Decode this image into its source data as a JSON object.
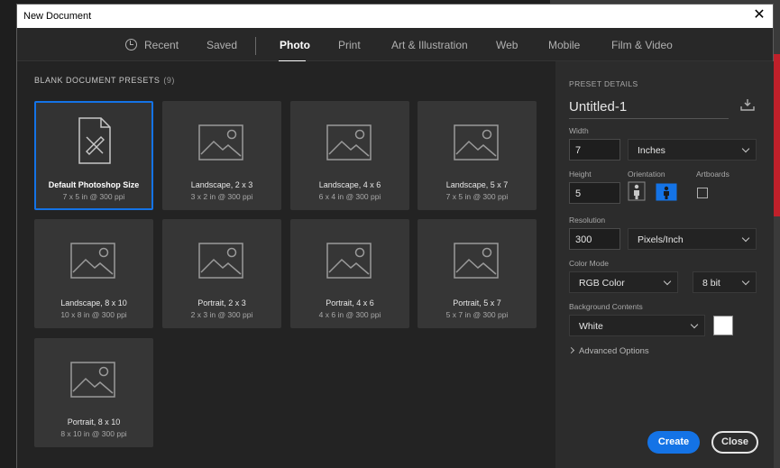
{
  "window": {
    "title": "New Document",
    "close_glyph": "✕"
  },
  "tabs": [
    {
      "label": "Recent",
      "icon": "clock-icon"
    },
    {
      "label": "Saved"
    },
    {
      "label": "Photo",
      "active": true
    },
    {
      "label": "Print"
    },
    {
      "label": "Art & Illustration"
    },
    {
      "label": "Web"
    },
    {
      "label": "Mobile"
    },
    {
      "label": "Film & Video"
    }
  ],
  "presets": {
    "header": "BLANK DOCUMENT PRESETS",
    "count": "(9)",
    "items": [
      {
        "name": "Default Photoshop Size",
        "size": "7 x 5 in @ 300 ppi",
        "icon": "document-brush-icon",
        "selected": true
      },
      {
        "name": "Landscape, 2 x 3",
        "size": "3 x 2 in @ 300 ppi",
        "icon": "image-icon"
      },
      {
        "name": "Landscape, 4 x 6",
        "size": "6 x 4 in @ 300 ppi",
        "icon": "image-icon"
      },
      {
        "name": "Landscape, 5 x 7",
        "size": "7 x 5 in @ 300 ppi",
        "icon": "image-icon"
      },
      {
        "name": "Landscape, 8 x 10",
        "size": "10 x 8 in @ 300 ppi",
        "icon": "image-icon"
      },
      {
        "name": "Portrait, 2 x 3",
        "size": "2 x 3 in @ 300 ppi",
        "icon": "image-icon"
      },
      {
        "name": "Portrait, 4 x 6",
        "size": "4 x 6 in @ 300 ppi",
        "icon": "image-icon"
      },
      {
        "name": "Portrait, 5 x 7",
        "size": "5 x 7 in @ 300 ppi",
        "icon": "image-icon"
      },
      {
        "name": "Portrait, 8 x 10",
        "size": "8 x 10 in @ 300 ppi",
        "icon": "image-icon"
      }
    ]
  },
  "details": {
    "header": "PRESET DETAILS",
    "doc_name": "Untitled-1",
    "width_label": "Width",
    "width_value": "7",
    "width_unit": "Inches",
    "height_label": "Height",
    "height_value": "5",
    "orientation_label": "Orientation",
    "artboards_label": "Artboards",
    "resolution_label": "Resolution",
    "resolution_value": "300",
    "resolution_unit": "Pixels/Inch",
    "color_mode_label": "Color Mode",
    "color_mode": "RGB Color",
    "bit_depth": "8 bit",
    "background_label": "Background Contents",
    "background": "White",
    "background_color": "#ffffff",
    "advanced": "Advanced Options",
    "create": "Create",
    "close": "Close"
  },
  "colors": {
    "accent": "#1473e6",
    "dialog_bg": "#282828",
    "card_bg": "#363636"
  }
}
